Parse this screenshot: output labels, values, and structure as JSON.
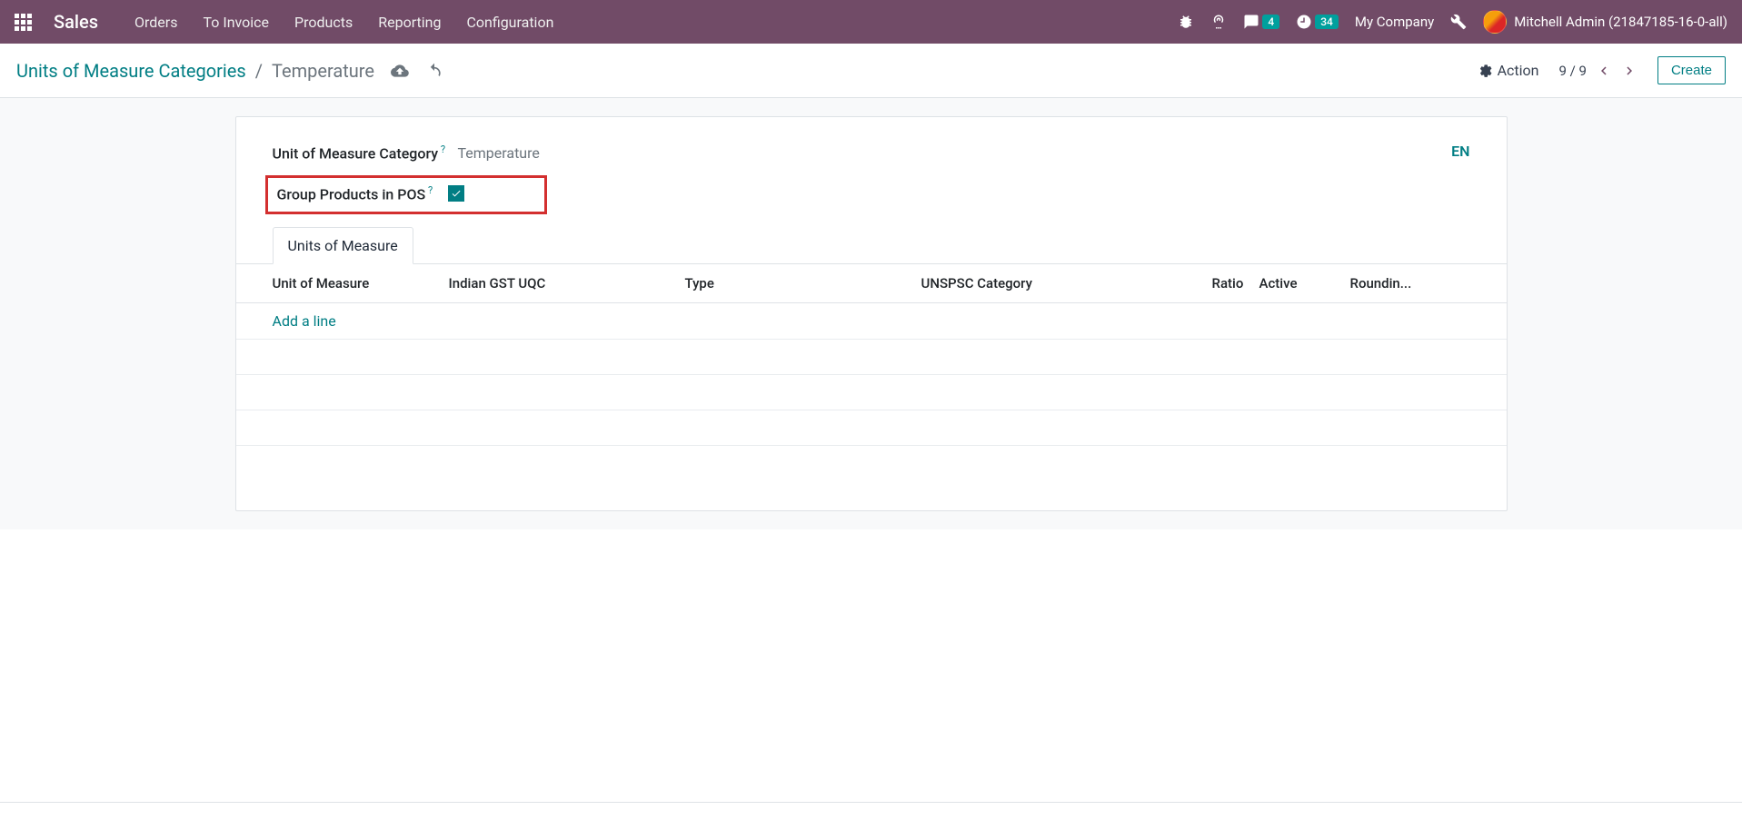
{
  "navbar": {
    "app_title": "Sales",
    "menu": [
      "Orders",
      "To Invoice",
      "Products",
      "Reporting",
      "Configuration"
    ],
    "messages_badge": "4",
    "activities_badge": "34",
    "company": "My Company",
    "user": "Mitchell Admin (21847185-16-0-all)"
  },
  "control": {
    "breadcrumb_root": "Units of Measure Categories",
    "breadcrumb_current": "Temperature",
    "action_label": "Action",
    "pager": "9 / 9",
    "create_label": "Create"
  },
  "form": {
    "category_label": "Unit of Measure Category",
    "category_value": "Temperature",
    "group_pos_label": "Group Products in POS",
    "lang": "EN"
  },
  "notebook": {
    "tab_label": "Units of Measure",
    "columns": {
      "uom": "Unit of Measure",
      "gst": "Indian GST UQC",
      "type": "Type",
      "unspsc": "UNSPSC Category",
      "ratio": "Ratio",
      "active": "Active",
      "rounding": "Roundin..."
    },
    "add_line": "Add a line"
  }
}
